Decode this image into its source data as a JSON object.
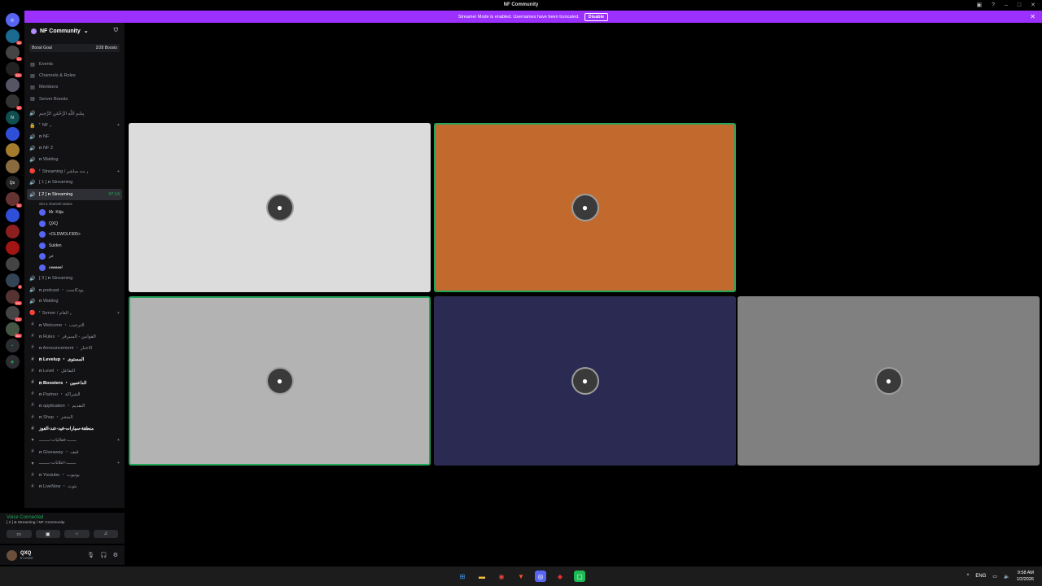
{
  "window": {
    "title": "NF Community"
  },
  "banner": {
    "text": "Streamer Mode is enabled. Usernames have been truncated.",
    "button": "Disable"
  },
  "guild": {
    "name": "NF Community"
  },
  "boost": {
    "label": "Boost Goal",
    "progress": "2/28 Boosts"
  },
  "nav": [
    "Events",
    "Channels & Roles",
    "Members",
    "Server Boosts"
  ],
  "channels": [
    {
      "icon": "🔊",
      "label": "بِسْمِ اللَّهِ الرَّحْمَٰنِ الرَّحِيمِ"
    },
    {
      "icon": "🔒",
      "label": "⸢ NF ⸥",
      "category": true
    },
    {
      "icon": "🔊",
      "label": "𝐧 NF"
    },
    {
      "icon": "🔊",
      "label": "𝐧 NF 2"
    },
    {
      "icon": "🔊",
      "label": "𝐧 Waiting"
    },
    {
      "icon": "🔴",
      "label": "⸢ Streaming / بث مباشر ⸥",
      "category": true
    },
    {
      "icon": "🔊",
      "label": "[ 1 ] 𝐧 Streaming"
    }
  ],
  "active_channel": {
    "label": "[ 2 ] 𝐧 Streaming",
    "time": "47:14",
    "status": "Set a channel status"
  },
  "voice_users": [
    "Mr. Kiija",
    "QXQ",
    "<OLDWOLF305>",
    "Sulden",
    "خز",
    "𝑣𝑒𝑒𝑒𝑒𝑒!"
  ],
  "channels2": [
    {
      "icon": "🔊",
      "label": "[ 3 ] 𝐧 Streaming"
    },
    {
      "icon": "🔊",
      "label": "𝐧 podcast ・ بودكاست"
    },
    {
      "icon": "🔊",
      "label": "𝐧 Waiting"
    },
    {
      "icon": "🔴",
      "label": "⸢ Server / العام ⸥",
      "category": true
    },
    {
      "icon": "#",
      "label": "𝐧 Welcome ・ الترحيب"
    },
    {
      "icon": "#",
      "label": "𝐧 Rules ・ القوانين - السيرفر"
    },
    {
      "icon": "#",
      "label": "𝐧 Announcement ・ الاخبار"
    },
    {
      "icon": "#",
      "label": "𝐧 Levelup ・ المستوى",
      "bold": true
    },
    {
      "icon": "#",
      "label": "𝐧 Level ・ التفاعل"
    },
    {
      "icon": "#",
      "label": "𝐧 Boosters ・ الداعمين",
      "bold": true
    },
    {
      "icon": "#",
      "label": "𝐧 Partner ・ الشراكة"
    },
    {
      "icon": "#",
      "label": "𝐧 application ・ التقديم"
    },
    {
      "icon": "#",
      "label": "𝐧 Shop ・ المتجر"
    },
    {
      "icon": "#",
      "label": "منطقة-سيارات-فيد-عند-الفوز",
      "bold": true
    },
    {
      "icon": "▾",
      "label": "ـــــــ-فعاليات-ــــــــ",
      "category": true
    },
    {
      "icon": "#",
      "label": "𝐧 Giveaway ・ قيف"
    },
    {
      "icon": "▾",
      "label": "ـــــــ-اعلانات-ــــــــ",
      "category": true
    },
    {
      "icon": "#",
      "label": "𝐧 Youtube ・ يوتيوب"
    },
    {
      "icon": "#",
      "label": "𝐧 LiveNow ・ بثوث"
    }
  ],
  "voice_panel": {
    "status": "Voice Connected",
    "channel": "[ 2 ] 𝐧 Streaming / NF Community"
  },
  "user": {
    "name": "QXQ",
    "status": "In voice"
  },
  "tiles": [
    {
      "color": "#dcdcdc",
      "speaking": false
    },
    {
      "color": "#c26a2e",
      "speaking": true
    },
    {
      "color": "#000000",
      "speaking": false
    },
    {
      "color": "#b3b3b3",
      "speaking": true
    },
    {
      "color": "#2b2a52",
      "speaking": false
    },
    {
      "color": "#808080",
      "speaking": false
    }
  ],
  "tray": {
    "lang": "ENG",
    "time": "9:58 AM",
    "date": "1/2/2026"
  }
}
